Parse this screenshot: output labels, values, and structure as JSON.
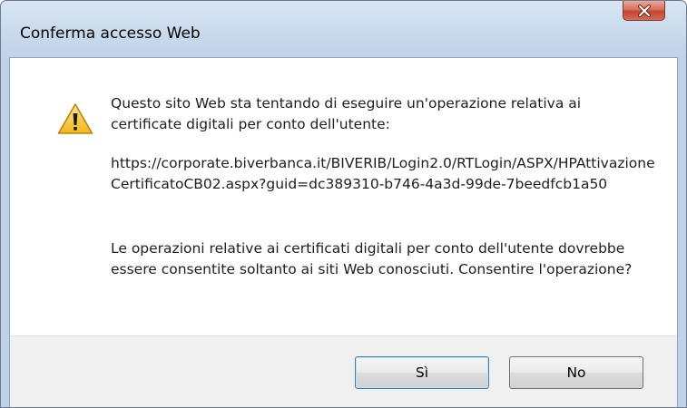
{
  "window": {
    "title": "Conferma accesso Web"
  },
  "dialog": {
    "message_intro": "Questo sito Web sta tentando di eseguire un'operazione relativa ai certificate digitali per conto dell'utente:",
    "url": "https://corporate.biverbanca.it/BIVERIB/Login2.0/RTLogin/ASPX/HPAttivazioneCertificatoCB02.aspx?guid=dc389310-b746-4a3d-99de-7beedfcb1a50",
    "message_question": "Le operazioni relative ai certificati digitali per conto dell'utente dovrebbe essere consentite soltanto ai siti Web conosciuti. Consentire l'operazione?",
    "icon": "warning-icon"
  },
  "buttons": {
    "yes_label": "Sì",
    "no_label": "No"
  },
  "colors": {
    "title_bar": "#cbdcee",
    "close_button": "#c5452e",
    "footer": "#f0f0f0",
    "warning": "#f7c52a"
  }
}
